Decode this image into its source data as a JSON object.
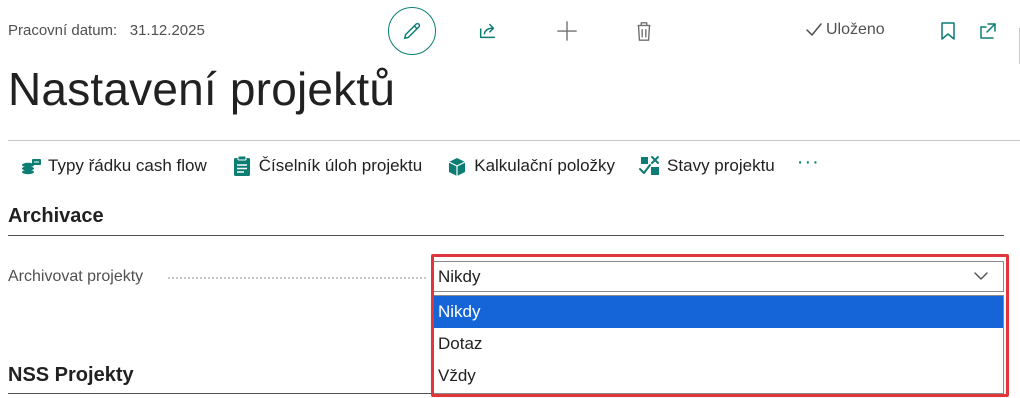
{
  "header": {
    "work_date_label": "Pracovní datum:",
    "work_date_value": "31.12.2025",
    "status_text": "Uloženo"
  },
  "page": {
    "title": "Nastavení projektů"
  },
  "actions": [
    {
      "label": "Typy řádku cash flow",
      "icon": "cash-flow-icon"
    },
    {
      "label": "Číselník úloh projektu",
      "icon": "clipboard-icon"
    },
    {
      "label": "Kalkulační položky",
      "icon": "box-icon"
    },
    {
      "label": "Stavy projektu",
      "icon": "status-icon"
    }
  ],
  "more_actions": "···",
  "sections": {
    "archive": {
      "title": "Archivace",
      "field_label": "Archivovat projekty",
      "field_value": "Nikdy",
      "options": [
        "Nikdy",
        "Dotaz",
        "Vždy"
      ],
      "selected_option": "Nikdy"
    },
    "nss": {
      "title": "NSS Projekty"
    }
  },
  "colors": {
    "accent": "#0b7d73",
    "selected_option_bg": "#1565d8",
    "highlight_border": "#e0353b"
  }
}
